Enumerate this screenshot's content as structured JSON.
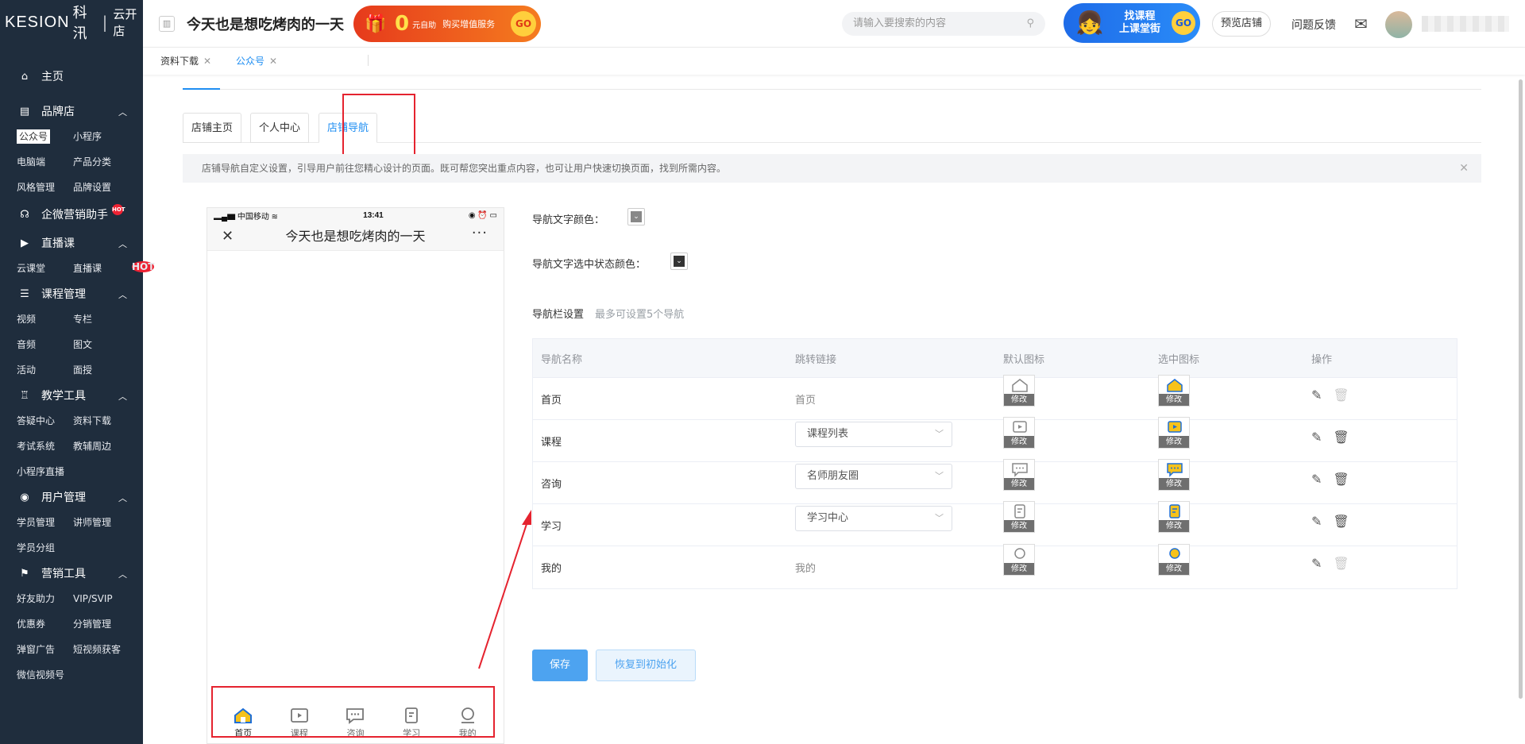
{
  "app": {
    "logo_brand": "KESION",
    "logo_cn": "科汛",
    "logo_sep": "|",
    "logo_product": "云开店"
  },
  "sidebar": {
    "home": "主页",
    "sections": [
      {
        "label": "品牌店",
        "icon": "store-icon",
        "items": [
          "公众号",
          "小程序",
          "电脑端",
          "产品分类",
          "风格管理",
          "品牌设置"
        ]
      },
      {
        "label": "企微营销助手",
        "icon": "chat-icon",
        "items": []
      },
      {
        "label": "直播课",
        "icon": "live-icon",
        "items": [
          "云课堂",
          "直播课"
        ]
      },
      {
        "label": "课程管理",
        "icon": "course-icon",
        "items": [
          "视频",
          "专栏",
          "音频",
          "图文",
          "活动",
          "面授"
        ]
      },
      {
        "label": "教学工具",
        "icon": "teaching-icon",
        "items": [
          "答疑中心",
          "资料下载",
          "考试系统",
          "教辅周边",
          "小程序直播"
        ]
      },
      {
        "label": "用户管理",
        "icon": "user-icon",
        "items": [
          "学员管理",
          "讲师管理",
          "学员分组"
        ]
      },
      {
        "label": "营销工具",
        "icon": "gift-icon",
        "items": [
          "好友助力",
          "VIP/SVIP",
          "优惠券",
          "分销管理",
          "弹窗广告",
          "短视频获客",
          "微信视频号"
        ]
      }
    ],
    "hot_badge": "HOT"
  },
  "header": {
    "store_title": "今天也是想吃烤肉的一天",
    "banner_zero": "0",
    "banner_text1": "元自助",
    "banner_text2": "购买增值服务",
    "banner_go": "GO",
    "search_placeholder": "请输入要搜索的内容",
    "promo_line1": "找课程",
    "promo_line2": "上课堂街",
    "promo_go": "GO",
    "preview_store": "预览店铺",
    "feedback": "问题反馈"
  },
  "tags": [
    {
      "label": "资料下载",
      "active": false
    },
    {
      "label": "公众号",
      "active": true
    }
  ],
  "subtabs": [
    "店铺主页",
    "个人中心",
    "店铺导航"
  ],
  "notice": "店铺导航自定义设置，引导用户前往您精心设计的页面。既可帮您突出重点内容，也可让用户快速切换页面，找到所需内容。",
  "phone": {
    "carrier": "中国移动",
    "time": "13:41",
    "title": "今天也是想吃烤肉的一天",
    "tabs": [
      "首页",
      "课程",
      "咨询",
      "学习",
      "我的"
    ]
  },
  "form": {
    "nav_text_color_label": "导航文字颜色：",
    "nav_text_active_color_label": "导航文字选中状态颜色：",
    "nav_text_color": "#888888",
    "nav_text_active_color": "#333333",
    "navbar_settings_label": "导航栏设置",
    "navbar_hint": "最多可设置5个导航"
  },
  "table": {
    "headers": [
      "导航名称",
      "跳转链接",
      "默认图标",
      "选中图标",
      "操作"
    ],
    "modify_label": "修改",
    "rows": [
      {
        "name": "首页",
        "link": "首页",
        "link_is_select": false,
        "icon": "home-icon",
        "deletable": false
      },
      {
        "name": "课程",
        "link": "课程列表",
        "link_is_select": true,
        "icon": "play-icon",
        "deletable": true
      },
      {
        "name": "咨询",
        "link": "名师朋友圈",
        "link_is_select": true,
        "icon": "message-icon",
        "deletable": true
      },
      {
        "name": "学习",
        "link": "学习中心",
        "link_is_select": true,
        "icon": "book-icon",
        "deletable": true
      },
      {
        "name": "我的",
        "link": "我的",
        "link_is_select": false,
        "icon": "user-circle-icon",
        "deletable": false
      }
    ]
  },
  "buttons": {
    "save": "保存",
    "reset": "恢复到初始化"
  },
  "colors": {
    "accent": "#1f8ef2",
    "sidebar_bg": "#1f2d3d",
    "highlight_red": "#e5232f",
    "selected_icon_yellow": "#f6c21b"
  }
}
